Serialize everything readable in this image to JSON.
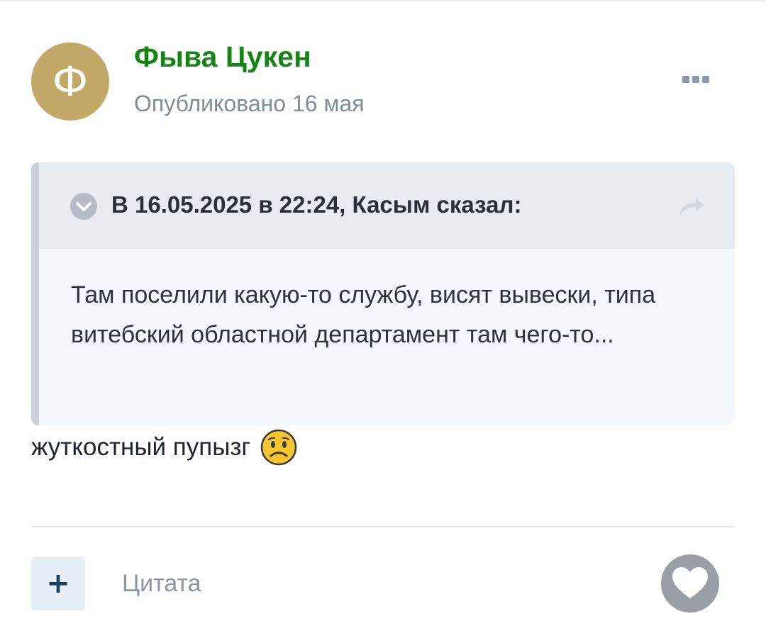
{
  "post": {
    "author": {
      "avatar_letter": "Ф",
      "avatar_color": "#c3a967",
      "name": "Фыва Цукен",
      "name_color": "#168516"
    },
    "published": "Опубликовано 16 мая",
    "menu_icon": "more-horizontal-icon",
    "quote": {
      "toggle_icon": "chevron-down-circle-icon",
      "citation": "В 16.05.2025 в 22:24, Касым сказал:",
      "share_icon": "share-arrow-icon",
      "text": "Там поселили какую-то службу, висят вывески, типа витебский областной департамент там чего-то..."
    },
    "content": {
      "text": "жуткостный пупызг",
      "emoji": "sad-face-emoji"
    },
    "footer": {
      "multiquote_icon": "plus-icon",
      "multiquote_symbol": "+",
      "quote_label": "Цитата",
      "reaction_icon": "heart-icon"
    }
  }
}
